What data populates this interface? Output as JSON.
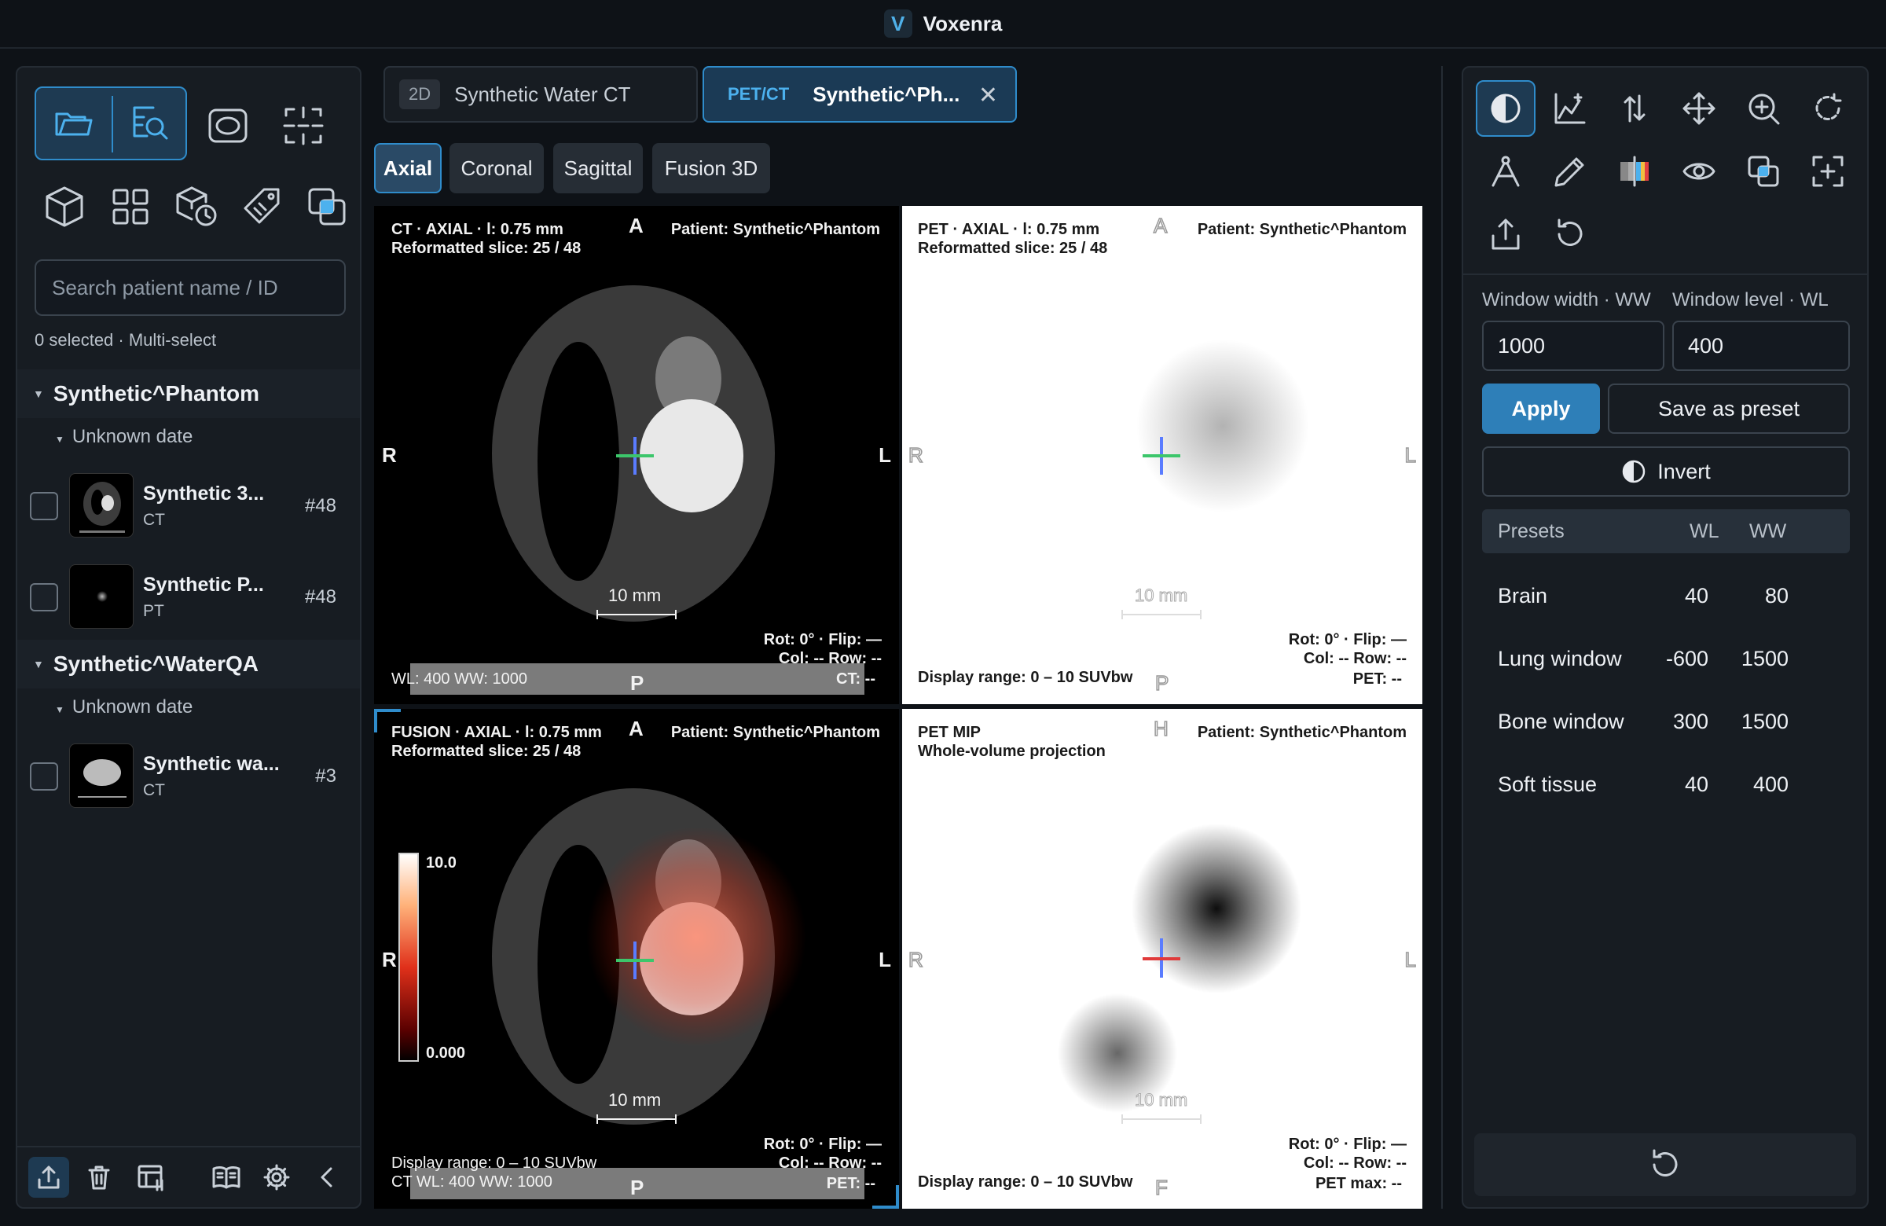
{
  "app": {
    "name": "Voxenra",
    "logo_letter": "V"
  },
  "left_panel": {
    "toolbar_icons": [
      "folder-open-icon",
      "search-study-icon",
      "ellipse-roi-icon",
      "crosshair-grid-icon",
      "cube-icon",
      "layout-grid-icon",
      "cube-history-icon",
      "tag-icon",
      "overlay-icon"
    ],
    "search": {
      "placeholder": "Search patient name / ID"
    },
    "selection": "0 selected · Multi-select",
    "patients": [
      {
        "name": "Synthetic^Phantom",
        "date": "Unknown date",
        "series": [
          {
            "name": "Synthetic 3...",
            "modality": "CT",
            "count": "#48"
          },
          {
            "name": "Synthetic P...",
            "modality": "PT",
            "count": "#48"
          }
        ]
      },
      {
        "name": "Synthetic^WaterQA",
        "date": "Unknown date",
        "series": [
          {
            "name": "Synthetic wa...",
            "modality": "CT",
            "count": "#3"
          }
        ]
      }
    ],
    "bottom_icons": [
      "export-icon",
      "trash-icon",
      "layout-table-icon",
      "book-icon",
      "gear-icon",
      "collapse-left-icon"
    ]
  },
  "tabs": [
    {
      "badge": "2D",
      "label": "Synthetic Water CT"
    },
    {
      "badge": "PET/CT",
      "label": "Synthetic^Ph...",
      "close": "✕"
    }
  ],
  "view_tabs": [
    "Axial",
    "Coronal",
    "Sagittal",
    "Fusion 3D"
  ],
  "viewports": {
    "ct": {
      "l1": "CT · AXIAL · l: 0.75 mm",
      "l2": "Reformatted slice: 25 / 48",
      "patient": "Patient: Synthetic^Phantom",
      "top": "A",
      "left": "R",
      "right": "L",
      "bottom": "P",
      "scale": "10 mm",
      "rot": "Rot: 0° · Flip: —",
      "colrow": "Col: --   Row: --",
      "br": "CT: --",
      "bl": "WL: 400   WW: 1000"
    },
    "pet": {
      "l1": "PET · AXIAL · l: 0.75 mm",
      "l2": "Reformatted slice: 25 / 48",
      "patient": "Patient: Synthetic^Phantom",
      "top": "A",
      "left": "R",
      "right": "L",
      "bottom": "P",
      "scale": "10 mm",
      "rot": "Rot: 0° · Flip: —",
      "colrow": "Col: --   Row: --",
      "br": "PET: --",
      "bl": "Display range: 0 – 10 SUVbw"
    },
    "fusion": {
      "l1": "FUSION · AXIAL · l: 0.75 mm",
      "l2": "Reformatted slice: 25 / 48",
      "patient": "Patient: Synthetic^Phantom",
      "top": "A",
      "left": "R",
      "right": "L",
      "bottom": "P",
      "scale": "10 mm",
      "cbar_max": "10.0",
      "cbar_min": "0.000",
      "rot": "Rot: 0° · Flip: —",
      "colrow": "Col: --   Row: --",
      "br": "PET: --",
      "bl1": "Display range: 0 – 10 SUVbw",
      "bl2": "CT WL: 400   WW: 1000"
    },
    "mip": {
      "l1": "PET MIP",
      "l2": "Whole-volume projection",
      "patient": "Patient: Synthetic^Phantom",
      "top": "H",
      "left": "R",
      "right": "L",
      "bottom": "F",
      "scale": "10 mm",
      "rot": "Rot: 0° · Flip: —",
      "colrow": "Col: --   Row: --",
      "br": "PET max: --",
      "bl": "Display range: 0 – 10 SUVbw"
    }
  },
  "right_panel": {
    "tool_icons": [
      "contrast-icon",
      "histogram-icon",
      "arrows-vertical-icon",
      "move-icon",
      "zoom-in-icon",
      "rotate-icon",
      "angle-measure-icon",
      "pencil-icon",
      "colormap-icon",
      "eye-icon",
      "overlay-icon",
      "fit-screen-icon",
      "export-icon",
      "reset-icon"
    ],
    "ww_label": "Window width · WW",
    "wl_label": "Window level · WL",
    "ww_value": "1000",
    "wl_value": "400",
    "apply": "Apply",
    "save_preset": "Save as preset",
    "invert": "Invert",
    "presets_header": {
      "name": "Presets",
      "wl": "WL",
      "ww": "WW"
    },
    "presets": [
      {
        "name": "Brain",
        "wl": "40",
        "ww": "80"
      },
      {
        "name": "Lung window",
        "wl": "-600",
        "ww": "1500"
      },
      {
        "name": "Bone window",
        "wl": "300",
        "ww": "1500"
      },
      {
        "name": "Soft tissue",
        "wl": "40",
        "ww": "400"
      }
    ]
  },
  "colors": {
    "accent": "#2f8ccb",
    "accent_text": "#4cb1ee",
    "panel": "#171c22",
    "background": "#0e1217"
  }
}
